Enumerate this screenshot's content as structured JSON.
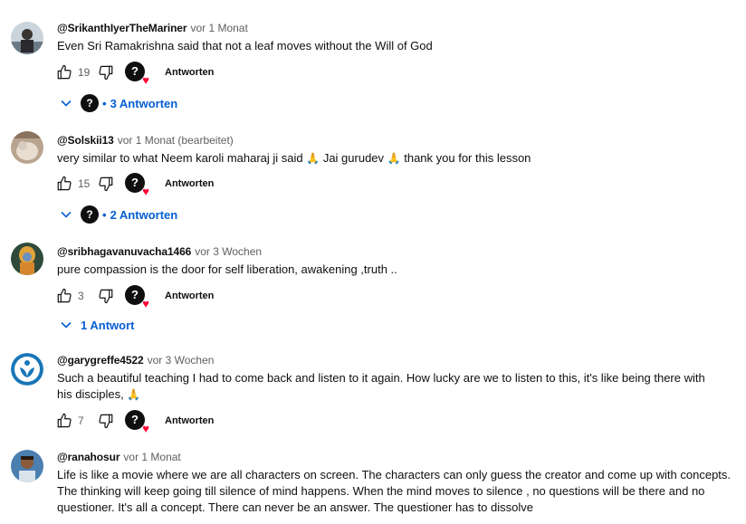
{
  "comments": [
    {
      "author": "@SrikanthIyerTheMariner",
      "time": "vor 1 Monat",
      "text": "Even Sri Ramakrishna said that not a leaf moves without the Will of God",
      "likes": "19",
      "reply_label": "Antworten",
      "replies_label": "3 Antworten"
    },
    {
      "author": "@Solskii13",
      "time": "vor 1 Monat (bearbeitet)",
      "text_parts": [
        "very similar to what Neem karoli maharaj ji said ",
        "🙏",
        " Jai gurudev ",
        "🙏",
        " thank you for this lesson"
      ],
      "likes": "15",
      "reply_label": "Antworten",
      "replies_label": "2 Antworten"
    },
    {
      "author": "@sribhagavanuvacha1466",
      "time": "vor 3 Wochen",
      "text": "pure compassion is the door for self liberation, awakening ,truth ..",
      "likes": "3",
      "reply_label": "Antworten",
      "replies_label": "1 Antwort"
    },
    {
      "author": "@garygreffe4522",
      "time": "vor 3 Wochen",
      "text_parts": [
        "Such a beautiful teaching I had to come back and listen to it again. How lucky are we to listen to this, it's like being there with his disciples, ",
        "🙏"
      ],
      "likes": "7",
      "reply_label": "Antworten"
    },
    {
      "author": "@ranahosur",
      "time": "vor 1 Monat",
      "text": "Life is like a movie where we are all characters on screen. The characters can only guess the creator and come up with concepts. The thinking will keep going till silence of mind happens. When the mind moves to silence , no questions will be there and no questioner. It's all a concept. There can never be an answer. The questioner has to dissolve"
    }
  ],
  "icons": {
    "like": "thumbs-up-icon",
    "dislike": "thumbs-down-icon",
    "creator_heart": "creator-heart-icon",
    "expand": "chevron-down-icon"
  },
  "colors": {
    "link": "#065fd4",
    "heart": "#ff0033",
    "secondary_text": "#606060"
  }
}
